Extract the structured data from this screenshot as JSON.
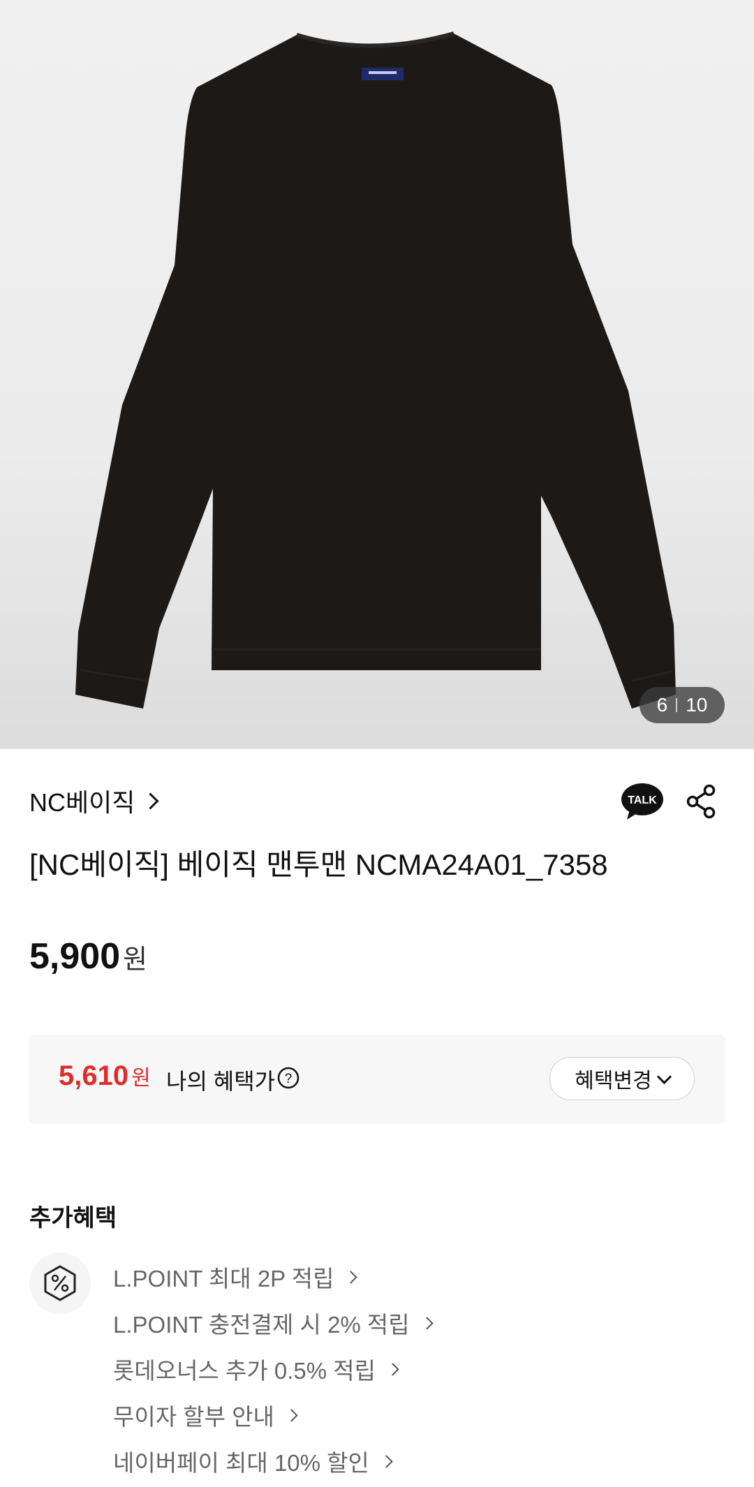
{
  "gallery": {
    "current": "6",
    "total": "10",
    "image_desc": "black crewneck sweatshirt"
  },
  "product": {
    "brand": "NC베이직",
    "title": "[NC베이직] 베이직 맨투맨 NCMA24A01_7358",
    "price": "5,900",
    "currency": "원"
  },
  "actions": {
    "talk_label": "TALK"
  },
  "benefit": {
    "price": "5,610",
    "currency": "원",
    "label": "나의 혜택가",
    "change_label": "혜택변경"
  },
  "extra": {
    "title": "추가혜택",
    "items": [
      "L.POINT 최대 2P 적립",
      "L.POINT 충전결제 시 2% 적립",
      "롯데오너스 추가 0.5% 적립",
      "무이자 할부 안내",
      "네이버페이 최대 10% 할인"
    ]
  },
  "colors": {
    "accent_red": "#e02b2b",
    "text": "#111111",
    "muted": "#666666"
  }
}
